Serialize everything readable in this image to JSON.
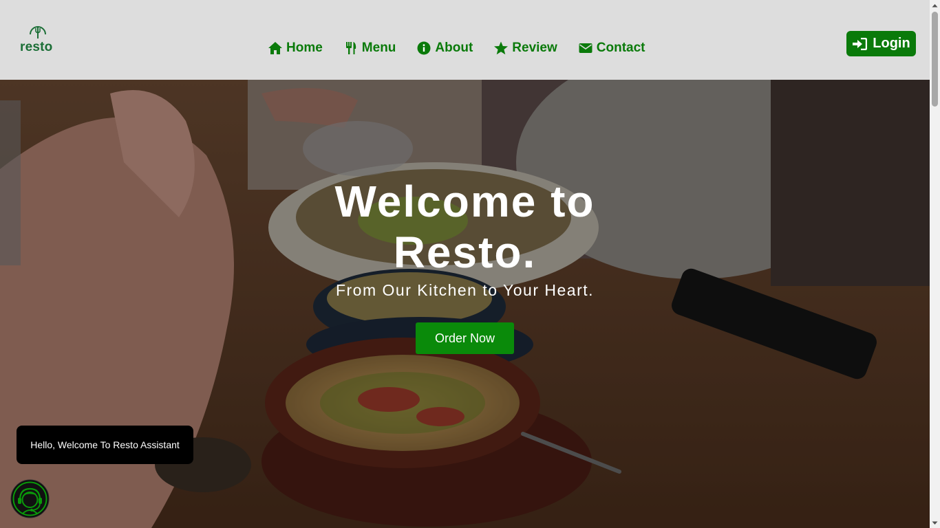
{
  "brand": {
    "logo_text": "resto",
    "logo_icon": "chef-fork-icon",
    "color": "#1b6e36"
  },
  "nav": {
    "items": [
      {
        "label": "Home",
        "icon": "home-icon"
      },
      {
        "label": "Menu",
        "icon": "utensils-icon"
      },
      {
        "label": "About",
        "icon": "info-icon"
      },
      {
        "label": "Review",
        "icon": "star-icon"
      },
      {
        "label": "Contact",
        "icon": "envelope-icon"
      }
    ],
    "accent": "#0a7a0a"
  },
  "login": {
    "label": "Login",
    "icon": "sign-in-icon"
  },
  "hero": {
    "title_line1": "Welcome to",
    "title_line2": "Resto.",
    "subtitle": "From Our Kitchen to Your Heart.",
    "cta_label": "Order Now"
  },
  "assistant": {
    "greeting": "Hello, Welcome To Resto Assistant",
    "icon": "support-agent-icon"
  },
  "colors": {
    "header_bg": "#dddddd",
    "primary_green": "#0a7a0a",
    "bubble_bg": "#000000"
  }
}
